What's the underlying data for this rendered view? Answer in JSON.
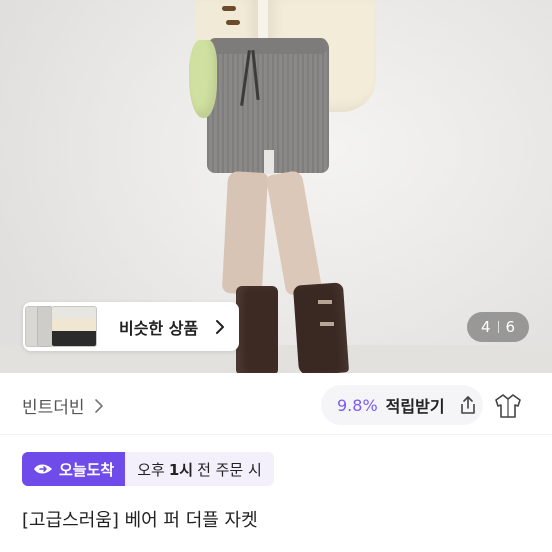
{
  "hero": {
    "similar_label": "비슷한 상품",
    "counter_current": "4",
    "counter_total": "6"
  },
  "shop": {
    "name": "빈트더빈",
    "points_rate": "9.8%",
    "points_label": "적립받기"
  },
  "delivery": {
    "badge": "오늘도착",
    "cutoff_prefix": "오후",
    "cutoff_time": "1시",
    "cutoff_suffix": "전 주문 시"
  },
  "product": {
    "title": "[고급스러움] 베어 퍼 더플 자켓"
  },
  "colors": {
    "accent": "#6f4cea",
    "points": "#7b5cf0",
    "badge_bg": "#f3f0fc"
  }
}
